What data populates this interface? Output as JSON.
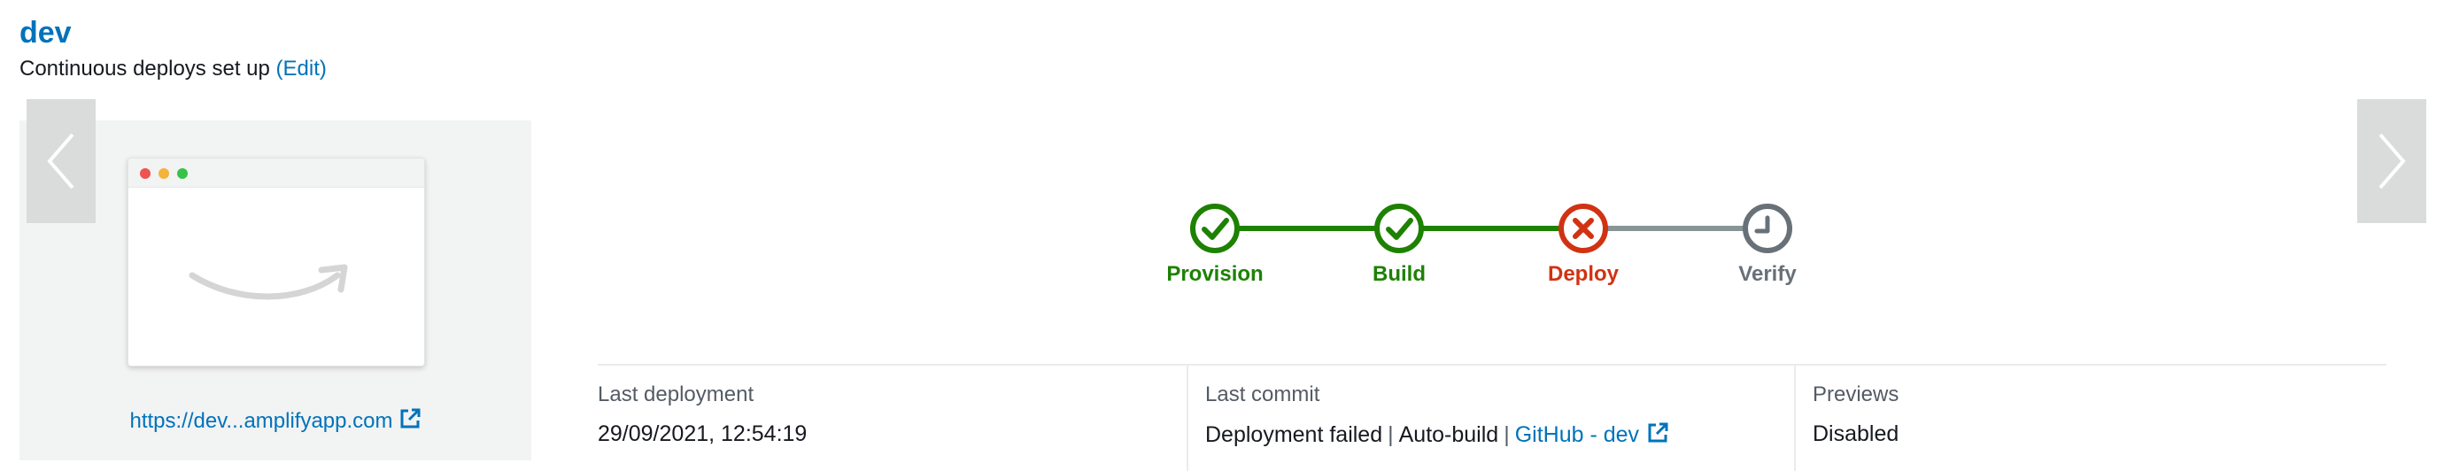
{
  "branch": {
    "name": "dev",
    "status_text": "Continuous deploys set up",
    "edit_label": "(Edit)"
  },
  "preview": {
    "url": "https://dev...amplifyapp.com"
  },
  "nav": {
    "prev_icon": "chevron-left-icon",
    "next_icon": "chevron-right-icon"
  },
  "pipeline": {
    "steps": [
      {
        "label": "Provision",
        "status": "success",
        "icon": "check-circle-icon",
        "color": "#1d8102"
      },
      {
        "label": "Build",
        "status": "success",
        "icon": "check-circle-icon",
        "color": "#1d8102"
      },
      {
        "label": "Deploy",
        "status": "failed",
        "icon": "x-circle-icon",
        "color": "#d13212"
      },
      {
        "label": "Verify",
        "status": "pending",
        "icon": "clock-icon",
        "color": "#687078"
      }
    ],
    "connector_colors": [
      "#1d8102",
      "#1d8102",
      "#879596"
    ]
  },
  "details": {
    "last_deployment": {
      "label": "Last deployment",
      "value": "29/09/2021, 12:54:19"
    },
    "last_commit": {
      "label": "Last commit",
      "status": "Deployment failed",
      "separator": "|",
      "trigger": "Auto-build",
      "repo_link": "GitHub - dev"
    },
    "previews": {
      "label": "Previews",
      "value": "Disabled"
    }
  },
  "colors": {
    "link": "#0073bb",
    "success": "#1d8102",
    "error": "#d13212",
    "pending": "#687078"
  }
}
